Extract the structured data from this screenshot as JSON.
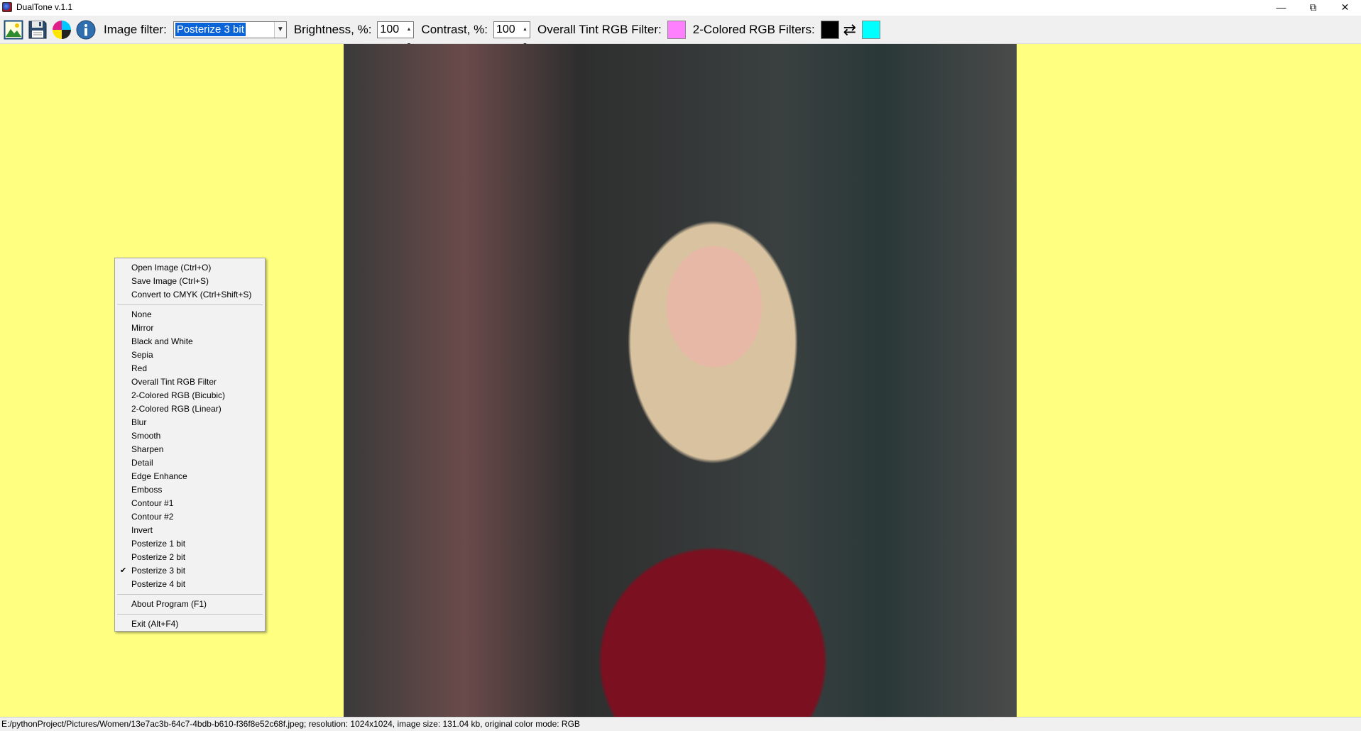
{
  "window": {
    "title": "DualTone v.1.1",
    "minimize_glyph": "—",
    "maximize_glyph": "⧉",
    "close_glyph": "✕"
  },
  "toolbar": {
    "image_filter_label": "Image filter:",
    "image_filter_value": "Posterize 3 bit",
    "brightness_label": "Brightness, %:",
    "brightness_value": "100",
    "contrast_label": "Contrast, %:",
    "contrast_value": "100",
    "tint_label": "Overall Tint RGB Filter:",
    "tint_color": "#ff80ff",
    "two_color_label": "2-Colored RGB Filters:",
    "two_color_first": "#000000",
    "two_color_second": "#00ffff",
    "icons": [
      "open-image-icon",
      "save-icon",
      "cmyk-icon",
      "info-icon"
    ]
  },
  "canvas": {
    "background": "#ffff80"
  },
  "context_menu": {
    "group1": [
      "Open Image (Ctrl+O)",
      "Save Image (Ctrl+S)",
      "Convert to CMYK (Ctrl+Shift+S)"
    ],
    "group2": [
      "None",
      "Mirror",
      "Black and White",
      "Sepia",
      "Red",
      "Overall Tint RGB Filter",
      "2-Colored RGB (Bicubic)",
      "2-Colored RGB (Linear)",
      "Blur",
      "Smooth",
      "Sharpen",
      "Detail",
      "Edge Enhance",
      "Emboss",
      "Contour #1",
      "Contour #2",
      "Invert",
      "Posterize 1 bit",
      "Posterize 2 bit",
      "Posterize 3 bit",
      "Posterize 4 bit"
    ],
    "checked_item": "Posterize 3 bit",
    "group3": [
      "About Program (F1)"
    ],
    "group4": [
      "Exit (Alt+F4)"
    ]
  },
  "statusbar": {
    "text": "E:/pythonProject/Pictures/Women/13e7ac3b-64c7-4bdb-b610-f36f8e52c68f.jpeg; resolution: 1024x1024, image size: 131.04 kb, original color mode: RGB"
  }
}
